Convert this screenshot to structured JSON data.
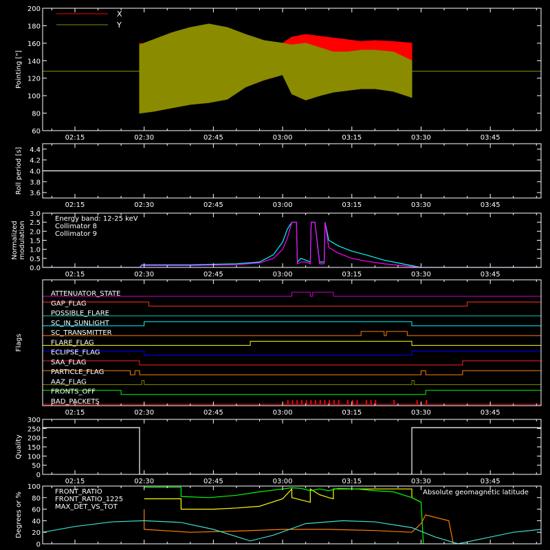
{
  "colors": {
    "background": "#000000",
    "axes": "#ffffff",
    "x_red": "#ff0000",
    "y_olive": "#8b8b00",
    "cyan": "#00ffff",
    "magenta": "#ff00ff",
    "orange": "#ff7f00",
    "yellow": "#ffff00",
    "green": "#00ff00",
    "blue": "#0000ff",
    "purple": "#d000d0",
    "olive_dark": "#808000",
    "lightcyan": "#40e0d0"
  },
  "chart_data": [
    {
      "id": "pointing",
      "type": "area",
      "ylabel": "Pointing [\"]",
      "ylim": [
        60,
        200
      ],
      "yticks": [
        "60",
        "80",
        "100",
        "120",
        "140",
        "160",
        "180",
        "200"
      ],
      "xticks": [
        "02:15",
        "02:30",
        "02:45",
        "03:00",
        "03:15",
        "03:30",
        "03:45"
      ],
      "xlim": [
        "02:08",
        "03:56"
      ],
      "legend": [
        {
          "name": "X",
          "color": "#ff0000"
        },
        {
          "name": "Y",
          "color": "#8b8b00"
        }
      ],
      "baseline": 128,
      "data_start": "02:29",
      "data_end": "03:28",
      "series": [
        {
          "name": "X",
          "x": [
            "02:29",
            "02:32",
            "02:36",
            "02:40",
            "02:44",
            "02:48",
            "02:52",
            "02:56",
            "03:00",
            "03:02",
            "03:05",
            "03:08",
            "03:11",
            "03:14",
            "03:17",
            "03:20",
            "03:24",
            "03:28"
          ],
          "low": [
            80,
            86,
            93,
            102,
            108,
            110,
            120,
            124,
            128,
            122,
            110,
            105,
            108,
            112,
            118,
            120,
            118,
            112
          ],
          "high": [
            160,
            158,
            156,
            158,
            160,
            158,
            154,
            157,
            160,
            167,
            170,
            168,
            166,
            164,
            162,
            163,
            162,
            160
          ]
        },
        {
          "name": "Y",
          "x": [
            "02:29",
            "02:32",
            "02:36",
            "02:40",
            "02:44",
            "02:48",
            "02:52",
            "02:56",
            "03:00",
            "03:02",
            "03:05",
            "03:08",
            "03:11",
            "03:14",
            "03:17",
            "03:20",
            "03:24",
            "03:28"
          ],
          "low": [
            80,
            82,
            86,
            90,
            92,
            96,
            110,
            118,
            124,
            102,
            95,
            100,
            104,
            106,
            108,
            108,
            105,
            98
          ],
          "high": [
            158,
            164,
            172,
            178,
            182,
            178,
            170,
            163,
            160,
            158,
            160,
            155,
            150,
            150,
            152,
            152,
            150,
            140
          ]
        }
      ]
    },
    {
      "id": "roll",
      "type": "line",
      "ylabel": "Roll period [s]",
      "ylim": [
        3.5,
        4.5
      ],
      "yticks": [
        "3.6",
        "3.8",
        "4.0",
        "4.2",
        "4.4"
      ],
      "xticks": [
        "02:15",
        "02:30",
        "02:45",
        "03:00",
        "03:15",
        "03:30",
        "03:45"
      ],
      "xlim": [
        "02:08",
        "03:56"
      ],
      "series": [
        {
          "name": "",
          "x": [
            "02:08",
            "03:56"
          ],
          "y": [
            4.0,
            4.0
          ],
          "color": "#ffffff"
        }
      ]
    },
    {
      "id": "modulation",
      "type": "line",
      "ylabel": "Normalized modulation",
      "ylim": [
        0,
        3.0
      ],
      "yticks": [
        "0.0",
        "0.5",
        "1.0",
        "1.5",
        "2.0",
        "2.5",
        "3.0"
      ],
      "xticks": [
        "02:15",
        "02:30",
        "02:45",
        "03:00",
        "03:15",
        "03:30",
        "03:45"
      ],
      "xlim": [
        "02:08",
        "03:56"
      ],
      "legend": [
        {
          "name": "Energy band: 12-25 keV",
          "color": "#ffffff"
        },
        {
          "name": "Collimator 8",
          "color": "#00ffff"
        },
        {
          "name": "Collimator 9",
          "color": "#ff00ff"
        }
      ],
      "series": [
        {
          "name": "Collimator 8",
          "color": "#00ffff",
          "x": [
            "02:08",
            "02:29",
            "02:29.5",
            "02:40",
            "02:50",
            "02:55",
            "02:58",
            "03:00",
            "03:01",
            "03:02",
            "03:03",
            "03:03.2",
            "03:04",
            "03:05",
            "03:06",
            "03:06.2",
            "03:07",
            "03:08",
            "03:09",
            "03:09.2",
            "03:10",
            "03:12",
            "03:15",
            "03:18",
            "03:22",
            "03:26",
            "03:28",
            "03:30",
            "03:56"
          ],
          "y": [
            0,
            0,
            0.15,
            0.15,
            0.2,
            0.3,
            0.7,
            1.4,
            2.1,
            2.5,
            2.5,
            0.3,
            0.5,
            0.4,
            0.3,
            2.5,
            2.5,
            0.3,
            0.3,
            2.5,
            1.5,
            1.2,
            0.9,
            0.7,
            0.4,
            0.2,
            0.1,
            0,
            0
          ]
        },
        {
          "name": "Collimator 9",
          "color": "#ff00ff",
          "x": [
            "02:08",
            "02:29",
            "02:29.5",
            "02:40",
            "02:50",
            "02:55",
            "02:58",
            "03:00",
            "03:01",
            "03:02",
            "03:03",
            "03:03.2",
            "03:04",
            "03:05",
            "03:06",
            "03:06.2",
            "03:07",
            "03:08",
            "03:09",
            "03:09.2",
            "03:10",
            "03:12",
            "03:15",
            "03:18",
            "03:22",
            "03:26",
            "03:28",
            "03:30",
            "03:56"
          ],
          "y": [
            0,
            0,
            0.1,
            0.1,
            0.15,
            0.25,
            0.5,
            1.0,
            1.6,
            2.5,
            2.5,
            0.2,
            0.3,
            0.3,
            0.2,
            2.5,
            2.5,
            0.2,
            0.2,
            2.5,
            1.1,
            0.8,
            0.5,
            0.35,
            0.2,
            0.1,
            0.05,
            0,
            0
          ]
        }
      ]
    },
    {
      "id": "flags",
      "type": "line",
      "ylabel": "Flags",
      "xticks": [
        "02:15",
        "02:30",
        "02:45",
        "03:00",
        "03:15",
        "03:30",
        "03:45"
      ],
      "xlim": [
        "02:08",
        "03:56"
      ],
      "series": [
        {
          "name": "ATTENUATOR_STATE",
          "color": "#d000d0",
          "x": [
            "02:08",
            "03:02",
            "03:02",
            "03:06",
            "03:06",
            "03:06.5",
            "03:06.5",
            "03:11",
            "03:11",
            "03:56"
          ],
          "y": [
            0,
            0,
            1,
            1,
            0,
            0,
            1,
            1,
            0,
            0
          ]
        },
        {
          "name": "GAP_FLAG",
          "color": "#ff3030",
          "x": [
            "02:08",
            "02:31",
            "02:31",
            "03:40",
            "03:40",
            "03:56"
          ],
          "y": [
            1,
            1,
            0,
            0,
            1,
            1
          ]
        },
        {
          "name": "POSSIBLE_FLARE",
          "color": "#00c0c0",
          "x": [
            "02:08",
            "03:56"
          ],
          "y": [
            0,
            0
          ]
        },
        {
          "name": "SC_IN_SUNLIGHT",
          "color": "#00ffff",
          "x": [
            "02:08",
            "02:30",
            "02:30",
            "03:28",
            "03:28",
            "03:56"
          ],
          "y": [
            0,
            0,
            1,
            1,
            0,
            0
          ]
        },
        {
          "name": "SC_TRANSMITTER",
          "color": "#ff7f00",
          "x": [
            "02:08",
            "03:17",
            "03:17",
            "03:22",
            "03:22",
            "03:22.5",
            "03:22.5",
            "03:27",
            "03:27",
            "03:56"
          ],
          "y": [
            0,
            0,
            1,
            1,
            0,
            0,
            1,
            1,
            0,
            0
          ]
        },
        {
          "name": "FLARE_FLAG",
          "color": "#ffff00",
          "x": [
            "02:08",
            "02:53",
            "02:53",
            "03:28",
            "03:28",
            "03:56"
          ],
          "y": [
            0,
            0,
            1,
            1,
            0,
            0
          ]
        },
        {
          "name": "ECLIPSE_FLAG",
          "color": "#0000ff",
          "x": [
            "02:08",
            "02:30",
            "02:30",
            "03:28",
            "03:28",
            "03:56"
          ],
          "y": [
            1,
            1,
            0,
            0,
            1,
            1
          ]
        },
        {
          "name": "SAA_FLAG",
          "color": "#ff2020",
          "x": [
            "02:08",
            "02:29",
            "02:29",
            "03:39",
            "03:39",
            "03:56"
          ],
          "y": [
            1,
            1,
            0,
            0,
            1,
            1
          ]
        },
        {
          "name": "PARTICLE_FLAG",
          "color": "#ff8000",
          "x": [
            "02:08",
            "02:27",
            "02:27",
            "02:28",
            "02:28",
            "02:29",
            "02:29",
            "03:30",
            "03:30",
            "03:31",
            "03:31",
            "03:39",
            "03:39",
            "03:56"
          ],
          "y": [
            1,
            1,
            0,
            0,
            1,
            1,
            0,
            0,
            1,
            1,
            0,
            0,
            1,
            1
          ]
        },
        {
          "name": "AAZ_FLAG",
          "color": "#808000",
          "x": [
            "02:08",
            "02:29.5",
            "02:29.5",
            "02:30",
            "02:30",
            "03:28",
            "03:28",
            "03:28.5",
            "03:28.5",
            "03:56"
          ],
          "y": [
            0,
            0,
            1,
            1,
            0,
            0,
            1,
            1,
            0,
            0
          ]
        },
        {
          "name": "FRONTS_OFF",
          "color": "#00ff00",
          "x": [
            "02:08",
            "02:25",
            "02:25",
            "03:31",
            "03:31",
            "03:56"
          ],
          "y": [
            1,
            1,
            0,
            0,
            1,
            1
          ]
        },
        {
          "name": "BAD_PACKETS",
          "color": "#ff0000",
          "spikes": [
            "03:01",
            "03:02",
            "03:03",
            "03:04",
            "03:05",
            "03:06",
            "03:07",
            "03:08",
            "03:09",
            "03:10",
            "03:11",
            "03:12",
            "03:14",
            "03:15",
            "03:16",
            "03:18",
            "03:19",
            "03:20",
            "03:24",
            "03:29",
            "03:31"
          ]
        }
      ]
    },
    {
      "id": "quality",
      "type": "line",
      "ylabel": "Quality",
      "ylim": [
        0,
        300
      ],
      "yticks": [
        "0",
        "50",
        "100",
        "150",
        "200",
        "250",
        "300"
      ],
      "xticks": [
        "02:15",
        "02:30",
        "02:45",
        "03:00",
        "03:15",
        "03:30",
        "03:45"
      ],
      "xlim": [
        "02:08",
        "03:56"
      ],
      "series": [
        {
          "name": "",
          "color": "#ffffff",
          "x": [
            "02:08",
            "02:29",
            "02:29",
            "03:28",
            "03:28",
            "03:56"
          ],
          "y": [
            255,
            255,
            0,
            0,
            255,
            255
          ]
        }
      ]
    },
    {
      "id": "ratios",
      "type": "line",
      "ylabel": "Degrees or %",
      "ylim": [
        0,
        100
      ],
      "yticks": [
        "0",
        "20",
        "40",
        "60",
        "80",
        "100"
      ],
      "xlim": [
        "02:08",
        "03:56"
      ],
      "legend": [
        {
          "name": "FRONT_RATIO",
          "color": "#ffff00"
        },
        {
          "name": "FRONT_RATIO_1225",
          "color": "#00ff00"
        },
        {
          "name": "MAX_DET_VS_TOT",
          "color": "#ff7f00"
        }
      ],
      "annotation": {
        "text": "Absolute geomagnetic latitude",
        "color": "#40e0d0"
      },
      "series": [
        {
          "name": "FRONT_RATIO",
          "color": "#ffff00",
          "x": [
            "02:30",
            "02:38",
            "02:38",
            "02:45",
            "02:50",
            "02:55",
            "03:00",
            "03:02",
            "03:02",
            "03:04",
            "03:06",
            "03:06",
            "03:08",
            "03:10",
            "03:11",
            "03:11",
            "03:20",
            "03:28",
            "03:28",
            "03:30"
          ],
          "y": [
            78,
            78,
            60,
            60,
            62,
            65,
            78,
            95,
            80,
            76,
            72,
            95,
            85,
            80,
            78,
            95,
            95,
            95,
            80,
            72
          ]
        },
        {
          "name": "FRONT_RATIO_1225",
          "color": "#00ff00",
          "x": [
            "02:30",
            "02:38",
            "02:38",
            "02:44",
            "02:50",
            "02:55",
            "03:00",
            "03:02",
            "03:04",
            "03:06",
            "03:08",
            "03:10",
            "03:12",
            "03:16",
            "03:20",
            "03:24",
            "03:28",
            "03:30",
            "03:30.5"
          ],
          "y": [
            98,
            98,
            82,
            80,
            84,
            90,
            95,
            97,
            96,
            92,
            95,
            92,
            96,
            95,
            92,
            90,
            80,
            72,
            0
          ]
        },
        {
          "name": "MAX_DET_VS_TOT",
          "color": "#ff7f00",
          "x": [
            "02:30",
            "02:30",
            "02:40",
            "02:50",
            "03:00",
            "03:10",
            "03:20",
            "03:28",
            "03:30",
            "03:31",
            "03:36",
            "03:37"
          ],
          "y": [
            60,
            25,
            20,
            22,
            25,
            25,
            23,
            20,
            35,
            50,
            40,
            0
          ]
        },
        {
          "name": "Absolute geomagnetic latitude",
          "color": "#40e0d0",
          "x": [
            "02:08",
            "02:15",
            "02:23",
            "02:30",
            "02:38",
            "02:45",
            "02:53",
            "02:58",
            "03:05",
            "03:13",
            "03:20",
            "03:28",
            "03:33",
            "03:38",
            "03:44",
            "03:50",
            "03:56"
          ],
          "y": [
            20,
            30,
            38,
            40,
            37,
            25,
            5,
            15,
            35,
            40,
            38,
            28,
            12,
            0,
            10,
            20,
            25
          ]
        }
      ]
    }
  ]
}
